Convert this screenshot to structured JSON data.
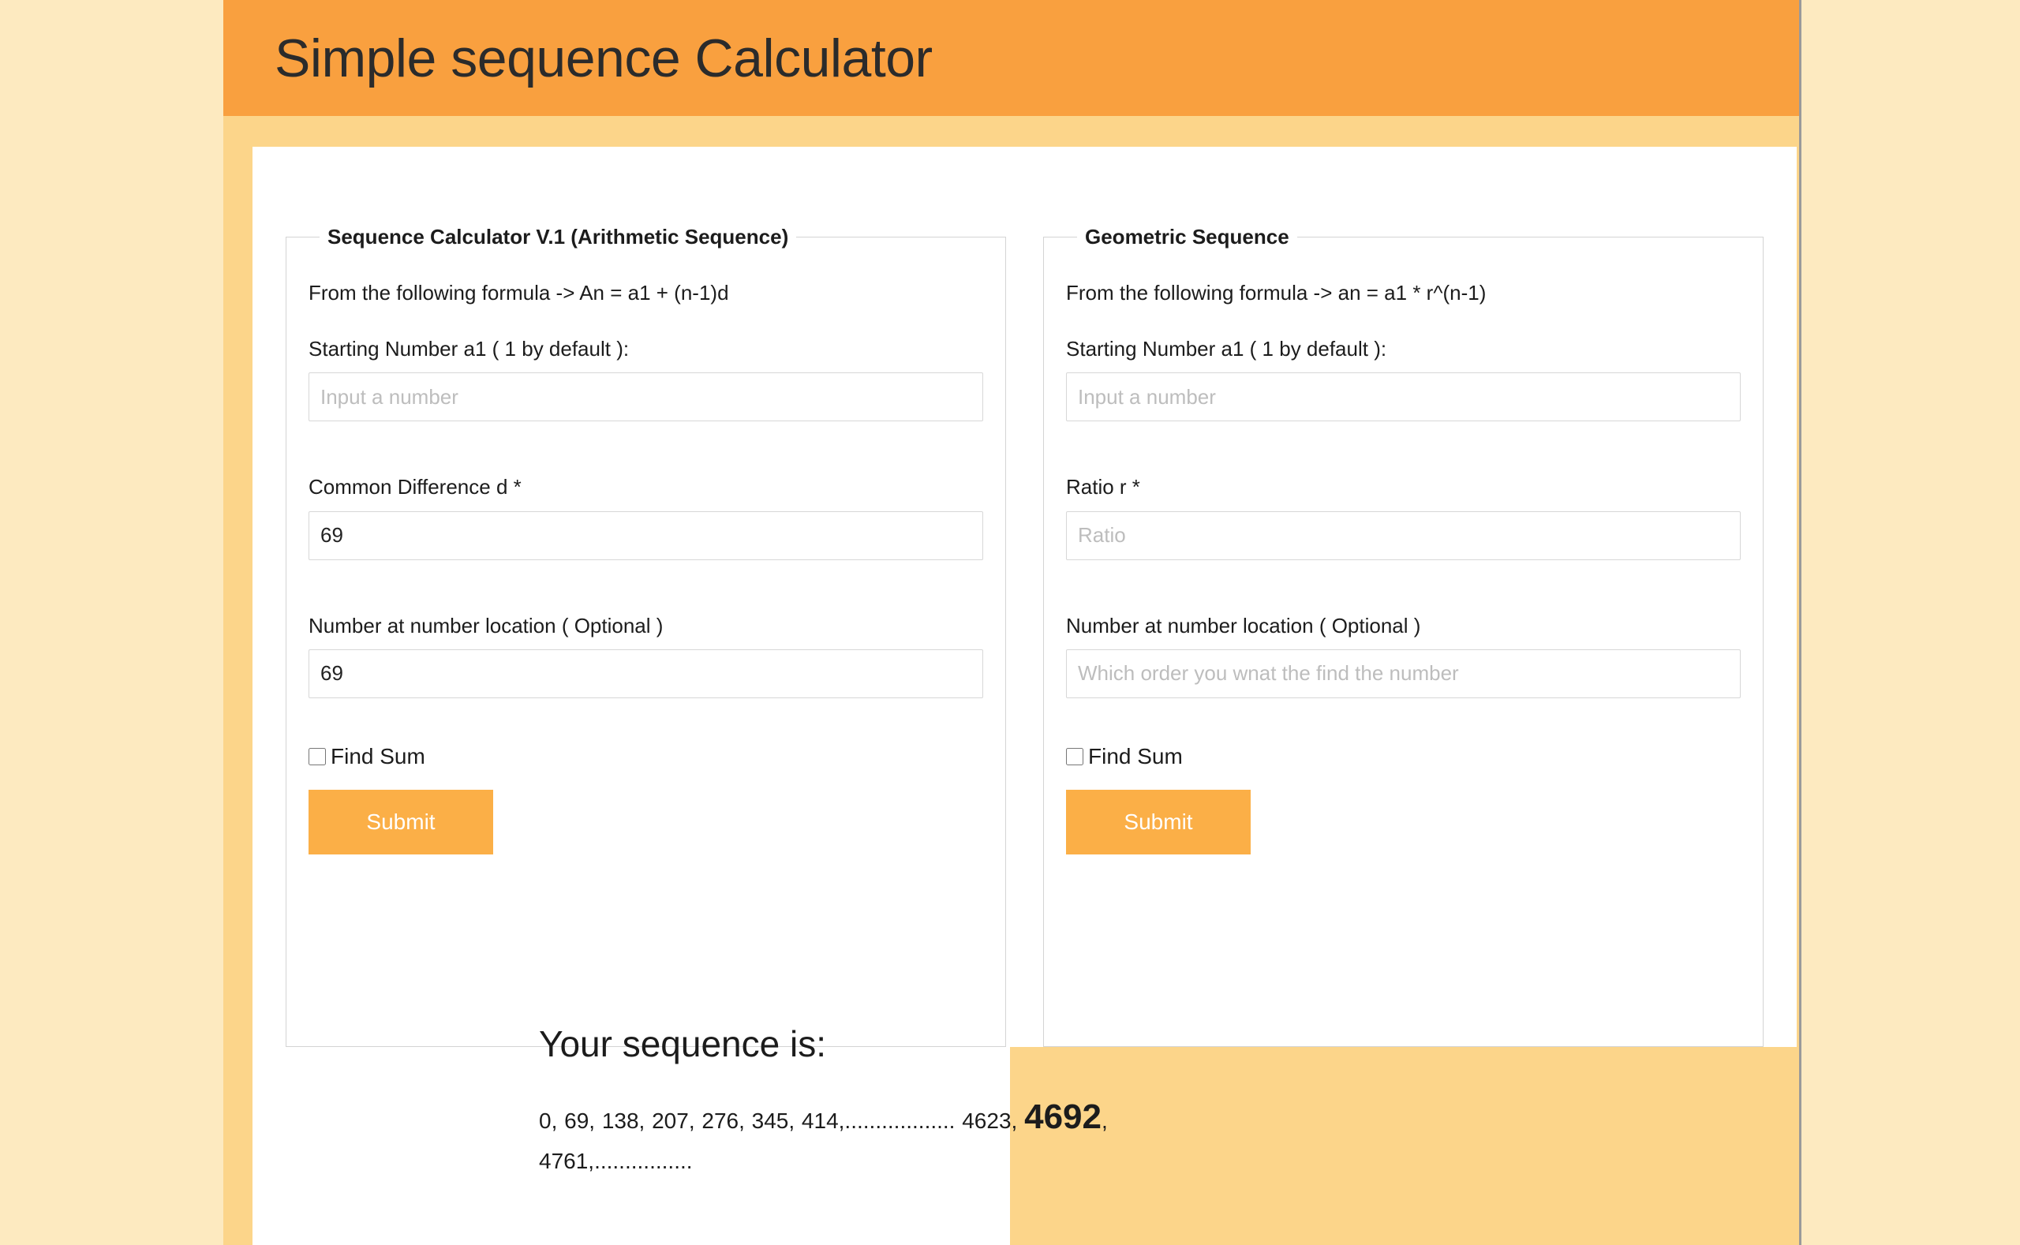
{
  "header": {
    "title": "Simple sequence Calculator",
    "background_color": "#f9a03f"
  },
  "theme": {
    "page_background": "#fdeac0",
    "shell_background": "#fcd58a",
    "card_background": "#ffffff",
    "accent_color": "#fbaf47",
    "text_color": "#1c1c1c",
    "placeholder_color": "#bdbdbd",
    "border_color": "#d4d4d4"
  },
  "arithmetic_panel": {
    "legend": "Sequence Calculator V.1 (Arithmetic Sequence)",
    "formula_text": "From the following formula -> An = a1 + (n-1)d",
    "start_label": "Starting Number a1 ( 1 by default ):",
    "start_value": "",
    "start_placeholder": "Input a number",
    "difference_label": "Common Difference d *",
    "difference_value": "69",
    "difference_placeholder": "",
    "location_label": "Number at number location ( Optional )",
    "location_value": "69",
    "location_placeholder": "",
    "find_sum_label": "Find Sum",
    "find_sum_checked": false,
    "submit_label": "Submit"
  },
  "geometric_panel": {
    "legend": "Geometric Sequence",
    "formula_text": "From the following formula -> an = a1 * r^(n-1)",
    "start_label": "Starting Number a1 ( 1 by default ):",
    "start_value": "",
    "start_placeholder": "Input a number",
    "ratio_label": "Ratio r *",
    "ratio_value": "",
    "ratio_placeholder": "Ratio",
    "location_label": "Number at number location ( Optional )",
    "location_value": "",
    "location_placeholder": "Which order you wnat the find the number",
    "find_sum_label": "Find Sum",
    "find_sum_checked": false,
    "submit_label": "Submit"
  },
  "result": {
    "heading": "Your sequence is:",
    "sequence_prefix": "0, 69, 138, 207, 276, 345, 414,.................. 4623, ",
    "highlight_value": "4692",
    "sequence_suffix": ", 4761,................"
  }
}
